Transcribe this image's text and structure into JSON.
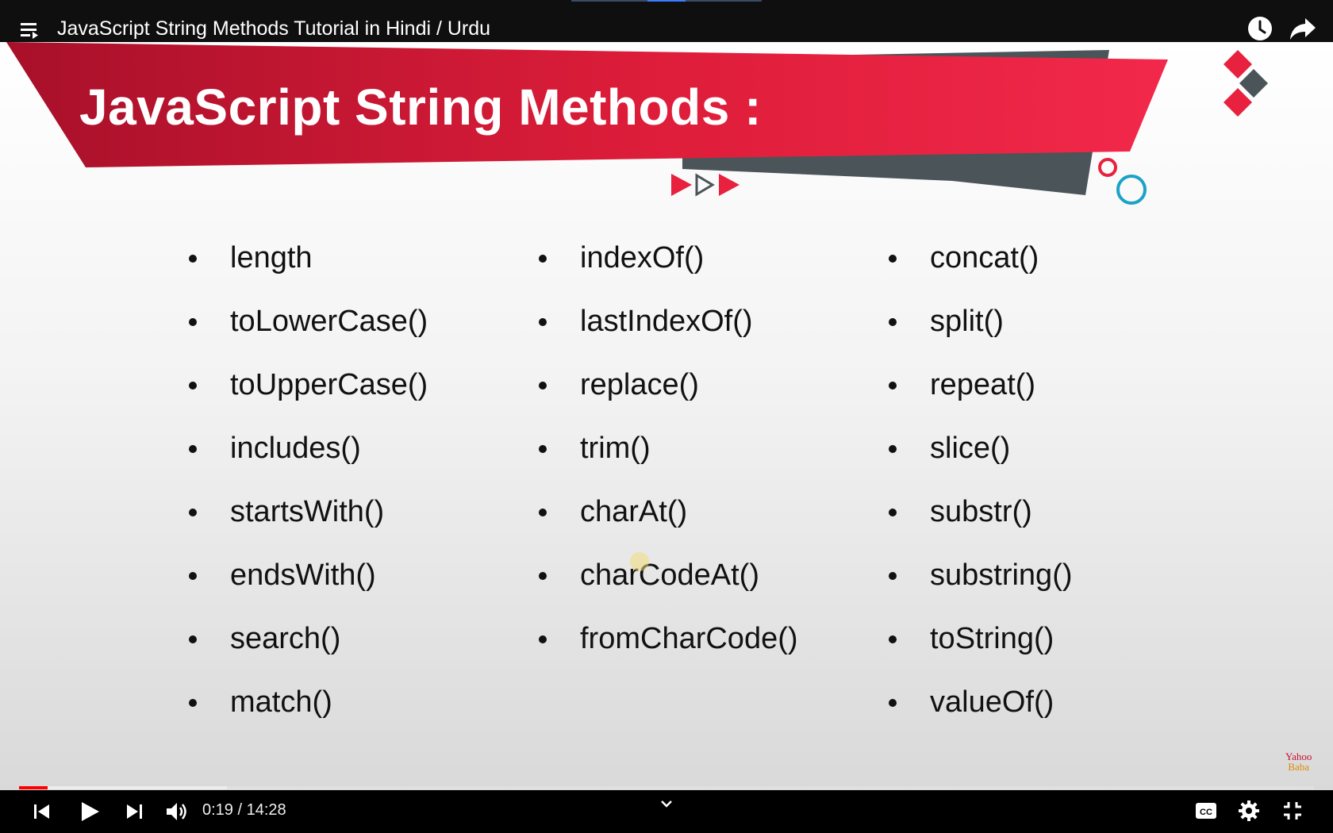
{
  "player": {
    "title": "JavaScript String Methods Tutorial in Hindi / Urdu",
    "current_time": "0:19",
    "duration": "14:28",
    "time_display": "0:19 / 14:28",
    "progress_fraction": 0.022,
    "accent_color": "#ff0000"
  },
  "slide": {
    "title": "JavaScript String Methods :",
    "columns": [
      [
        "length",
        "toLowerCase()",
        "toUpperCase()",
        "includes()",
        "startsWith()",
        "endsWith()",
        "search()",
        "match()"
      ],
      [
        "indexOf()",
        "lastIndexOf()",
        "replace()",
        "trim()",
        "charAt()",
        "charCodeAt()",
        "fromCharCode()"
      ],
      [
        "concat()",
        "split()",
        "repeat()",
        "slice()",
        "substr()",
        "substring()",
        "toString()",
        "valueOf()"
      ]
    ],
    "brand_colors": {
      "red": "#e8213f",
      "dark_red": "#a8102a",
      "slate": "#4a5459",
      "teal": "#1aa3c8"
    },
    "logo": {
      "line1": "Yahoo",
      "line2": "Baba"
    }
  },
  "icons": {
    "menu": "playlist-menu-icon",
    "watch_later": "clock-icon",
    "share": "share-arrow-icon",
    "prev": "previous-icon",
    "play": "play-icon",
    "next": "next-icon",
    "volume": "volume-icon",
    "expand": "chevron-down-icon",
    "captions": "captions-icon",
    "settings": "gear-icon",
    "exit_fullscreen": "exit-fullscreen-icon"
  }
}
